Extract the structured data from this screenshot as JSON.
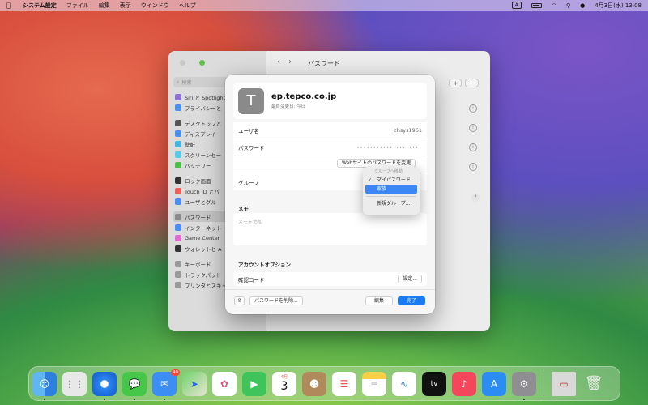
{
  "menubar": {
    "app_name": "システム設定",
    "menus": [
      "ファイル",
      "編集",
      "表示",
      "ウインドウ",
      "ヘルプ"
    ],
    "input_indicator": "A",
    "datetime": "4月3日(水) 13:08"
  },
  "settings": {
    "search_placeholder": "検索",
    "title": "パスワード",
    "sidebar_items": [
      "Siri と Spotlight",
      "プライバシーと",
      "デスクトップと",
      "ディスプレイ",
      "壁紙",
      "スクリーンセー",
      "バッテリー",
      "ロック画面",
      "Touch ID とパ",
      "ユーザとグル",
      "パスワード",
      "インターネット",
      "Game Center",
      "ウォレットと A",
      "キーボード",
      "トラックパッド",
      "プリンタとスキャナ"
    ],
    "toolbar": {
      "add": "+",
      "more": "···"
    },
    "help": "?"
  },
  "sheet": {
    "avatar_letter": "T",
    "site": "ep.tepco.co.jp",
    "last_modified": "最終変更日: 今日",
    "username_label": "ユーザ名",
    "username_value": "chsys1961",
    "password_label": "パスワード",
    "password_value": "••••••••••••••••••••",
    "change_password_button": "Webサイトのパスワードを変更",
    "group_label": "グループ",
    "memo_label": "メモ",
    "memo_placeholder": "メモを追加",
    "account_options_label": "アカウントオプション",
    "verification_code_label": "確認コード",
    "setup_button": "設定...",
    "delete_button": "パスワードを削除...",
    "edit_button": "編集",
    "done_button": "完了"
  },
  "group_menu": {
    "header": "グループへ移動",
    "items": [
      "マイパスワード",
      "家族",
      "新規グループ..."
    ],
    "checked": "マイパスワード",
    "highlighted": "家族"
  },
  "dock": {
    "mail_badge": "40",
    "calendar_month": "4月",
    "calendar_day": "3",
    "tv_label": "tv"
  }
}
